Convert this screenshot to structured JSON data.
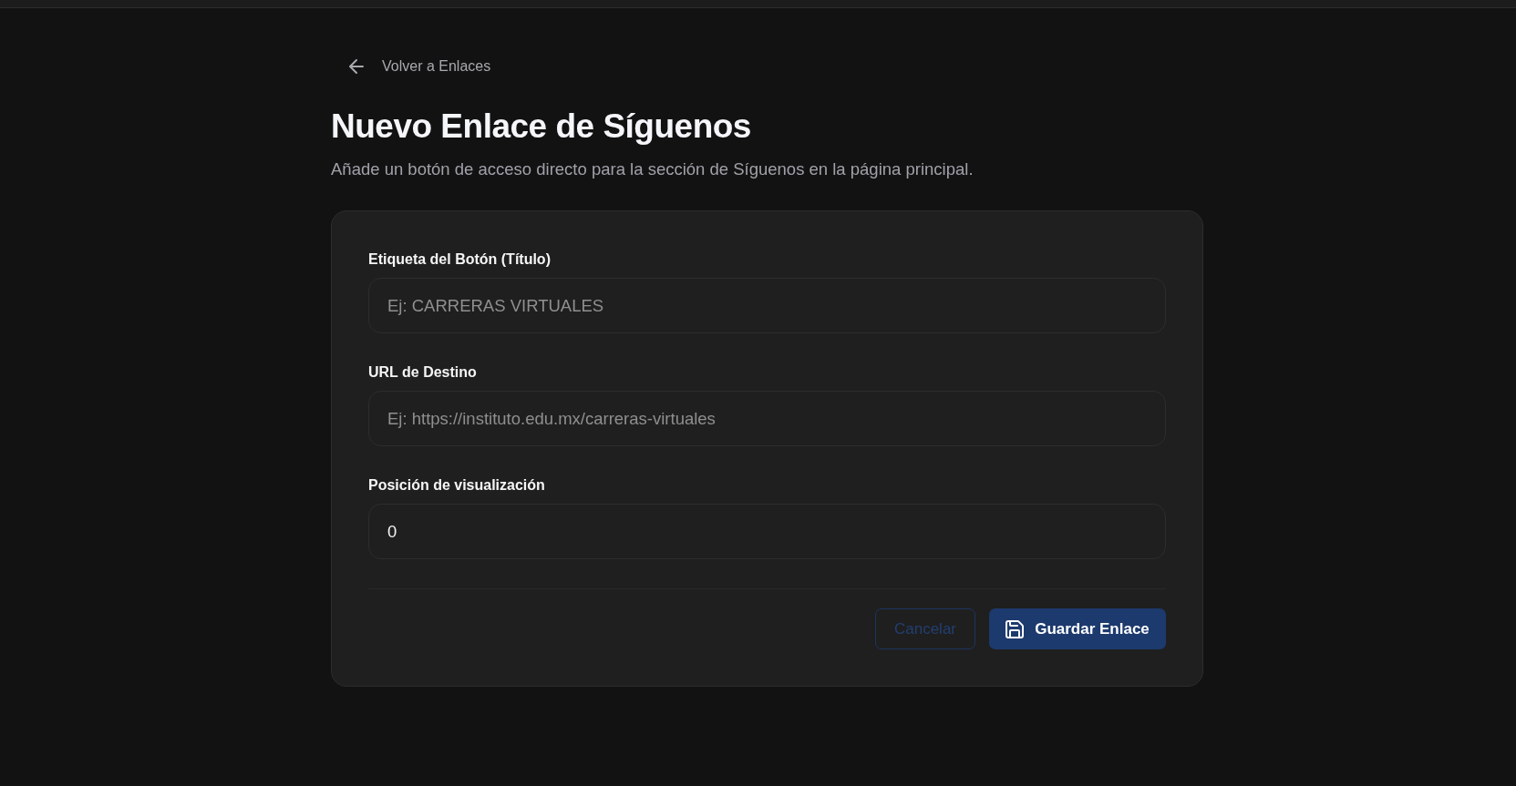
{
  "back_link": {
    "label": "Volver a Enlaces"
  },
  "title": "Nuevo Enlace de Síguenos",
  "subtitle": "Añade un botón de acceso directo para la sección de Síguenos en la página principal.",
  "form": {
    "fields": [
      {
        "label": "Etiqueta del Botón (Título)",
        "placeholder": "Ej: CARRERAS VIRTUALES"
      },
      {
        "label": "URL de Destino",
        "placeholder": "Ej: https://instituto.edu.mx/carreras-virtuales"
      },
      {
        "label": "Posición de visualización",
        "value": "0"
      }
    ],
    "buttons": [
      {
        "label": "Cancelar",
        "kind": "secondary"
      },
      {
        "label": "Guardar Enlace",
        "kind": "primary"
      }
    ]
  }
}
